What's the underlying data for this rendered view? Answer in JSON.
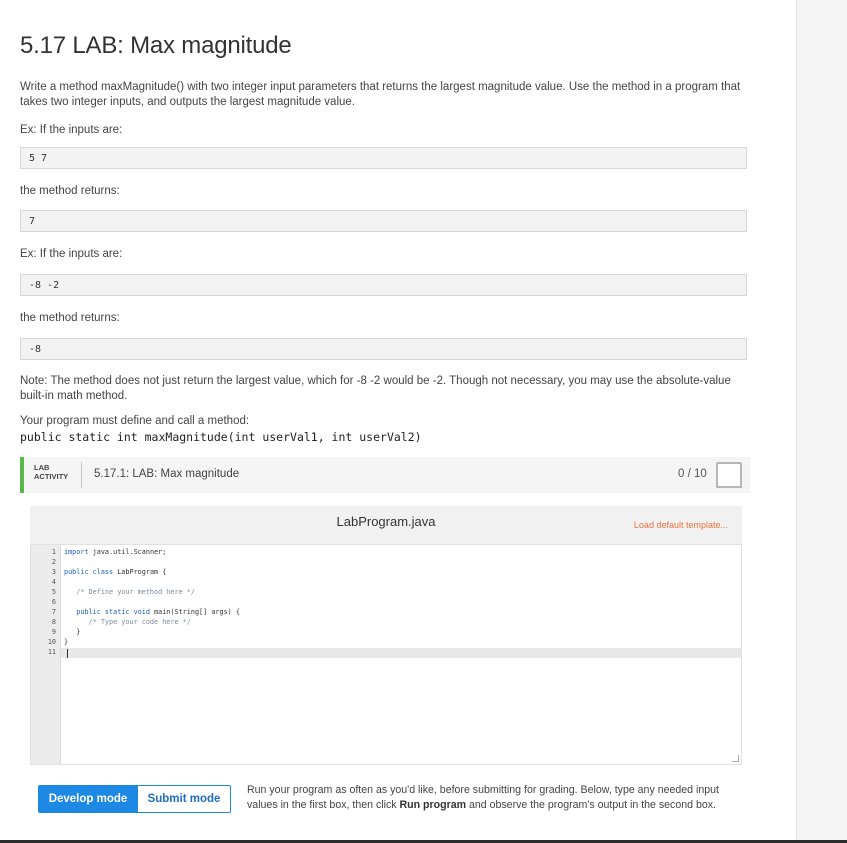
{
  "page": {
    "title": "5.17 LAB: Max magnitude",
    "intro": "Write a method maxMagnitude() with two integer input parameters that returns the largest magnitude value. Use the method in a program that takes two integer inputs, and outputs the largest magnitude value.",
    "ex1_label": "Ex: If the inputs are:",
    "ex1_input": "5 7",
    "ex1_returns_label": "the method returns:",
    "ex1_output": "7",
    "ex2_label": "Ex: If the inputs are:",
    "ex2_input": "-8 -2",
    "ex2_returns_label": "the method returns:",
    "ex2_output": "-8",
    "note": "Note: The method does not just return the largest value, which for -8 -2 would be -2. Though not necessary, you may use the absolute-value built-in math method.",
    "define_label": "Your program must define and call a method:",
    "signature": "public static int maxMagnitude(int userVal1, int userVal2)"
  },
  "lab": {
    "tag_line1": "LAB",
    "tag_line2": "ACTIVITY",
    "name": "5.17.1: LAB: Max magnitude",
    "score": "0 / 10"
  },
  "editor": {
    "filename": "LabProgram.java",
    "load_template": "Load default template...",
    "line_numbers": [
      "1",
      "2",
      "3",
      "4",
      "5",
      "6",
      "7",
      "8",
      "9",
      "10",
      "11"
    ],
    "lines": {
      "l1_kw": "import",
      "l1_rest": " java.util.Scanner;",
      "l3_kw": "public class",
      "l3_rest": " LabProgram {",
      "l5": "   /* Define your method here */",
      "l7_kw": "   public static void",
      "l7_rest": " main(String[] args) {",
      "l8": "      /* Type your code here */",
      "l9": "   }",
      "l10": "}"
    }
  },
  "modes": {
    "develop": "Develop mode",
    "submit": "Submit mode"
  },
  "run_help": {
    "part1": "Run your program as often as you'd like, before submitting for grading. Below, type any needed input values in the first box, then click ",
    "run_program": "Run program",
    "part2": " and observe the program's output in the second box."
  }
}
